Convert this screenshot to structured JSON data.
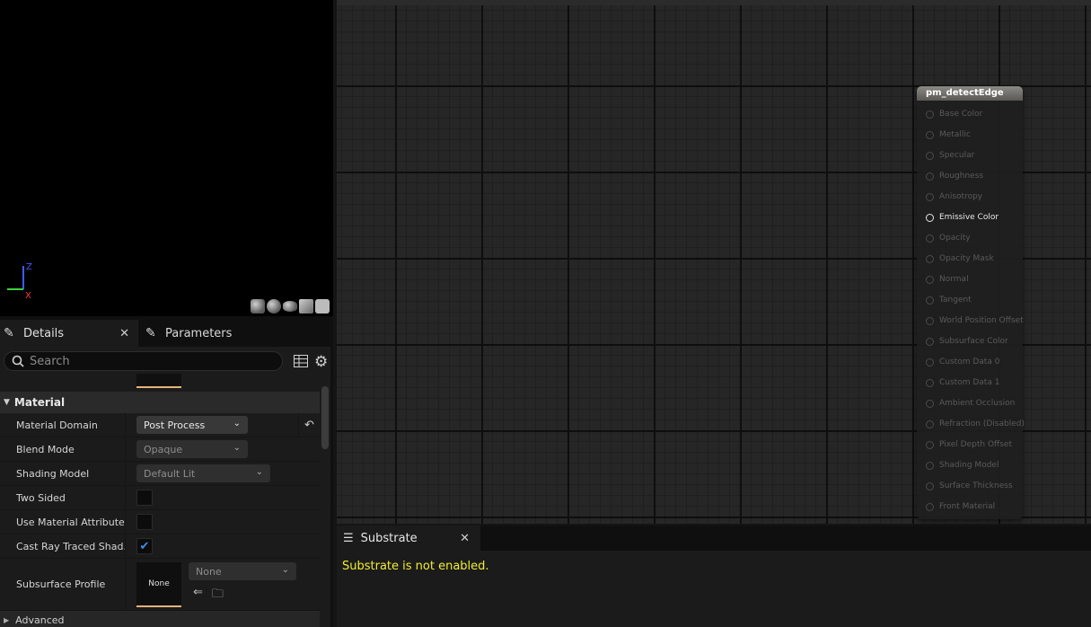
{
  "viewport": {
    "axis": {
      "z": "Z",
      "x": "X",
      "y": "Y"
    },
    "preview_shapes": [
      "cylinder-icon",
      "sphere-icon",
      "plane-icon",
      "cube-icon",
      "custom-mesh-icon"
    ]
  },
  "details_panel": {
    "tabs": [
      {
        "label": "Details",
        "icon": "pencil-icon",
        "closable": true
      },
      {
        "label": "Parameters",
        "icon": "pencil-icon"
      }
    ],
    "search": {
      "placeholder": "Search",
      "value": ""
    },
    "category": "Material",
    "properties": [
      {
        "label": "Material Domain",
        "type": "dropdown",
        "value": "Post Process",
        "enabled": true,
        "resettable": true
      },
      {
        "label": "Blend Mode",
        "type": "dropdown",
        "value": "Opaque",
        "enabled": false
      },
      {
        "label": "Shading Model",
        "type": "dropdown",
        "value": "Default Lit",
        "enabled": false
      },
      {
        "label": "Two Sided",
        "type": "checkbox",
        "checked": false
      },
      {
        "label": "Use Material Attributes",
        "type": "checkbox",
        "checked": false
      },
      {
        "label": "Cast Ray Traced Shad...",
        "type": "checkbox",
        "checked": true
      }
    ],
    "subsurface": {
      "label": "Subsurface Profile",
      "thumb": "None",
      "value": "None"
    },
    "advanced": "Advanced"
  },
  "graph": {
    "node": {
      "title": "pm_detectEdge",
      "pins": [
        {
          "label": "Base Color",
          "active": false
        },
        {
          "label": "Metallic",
          "active": false
        },
        {
          "label": "Specular",
          "active": false
        },
        {
          "label": "Roughness",
          "active": false
        },
        {
          "label": "Anisotropy",
          "active": false
        },
        {
          "label": "Emissive Color",
          "active": true
        },
        {
          "label": "Opacity",
          "active": false
        },
        {
          "label": "Opacity Mask",
          "active": false
        },
        {
          "label": "Normal",
          "active": false
        },
        {
          "label": "Tangent",
          "active": false
        },
        {
          "label": "World Position Offset",
          "active": false
        },
        {
          "label": "Subsurface Color",
          "active": false
        },
        {
          "label": "Custom Data 0",
          "active": false
        },
        {
          "label": "Custom Data 1",
          "active": false
        },
        {
          "label": "Ambient Occlusion",
          "active": false
        },
        {
          "label": "Refraction (Disabled)",
          "active": false
        },
        {
          "label": "Pixel Depth Offset",
          "active": false
        },
        {
          "label": "Shading Model",
          "active": false
        },
        {
          "label": "Surface Thickness",
          "active": false
        },
        {
          "label": "Front Material",
          "active": false
        }
      ]
    }
  },
  "substrate_panel": {
    "tab_label": "Substrate",
    "message": "Substrate is not enabled.",
    "message_color": "#f2ee30"
  }
}
